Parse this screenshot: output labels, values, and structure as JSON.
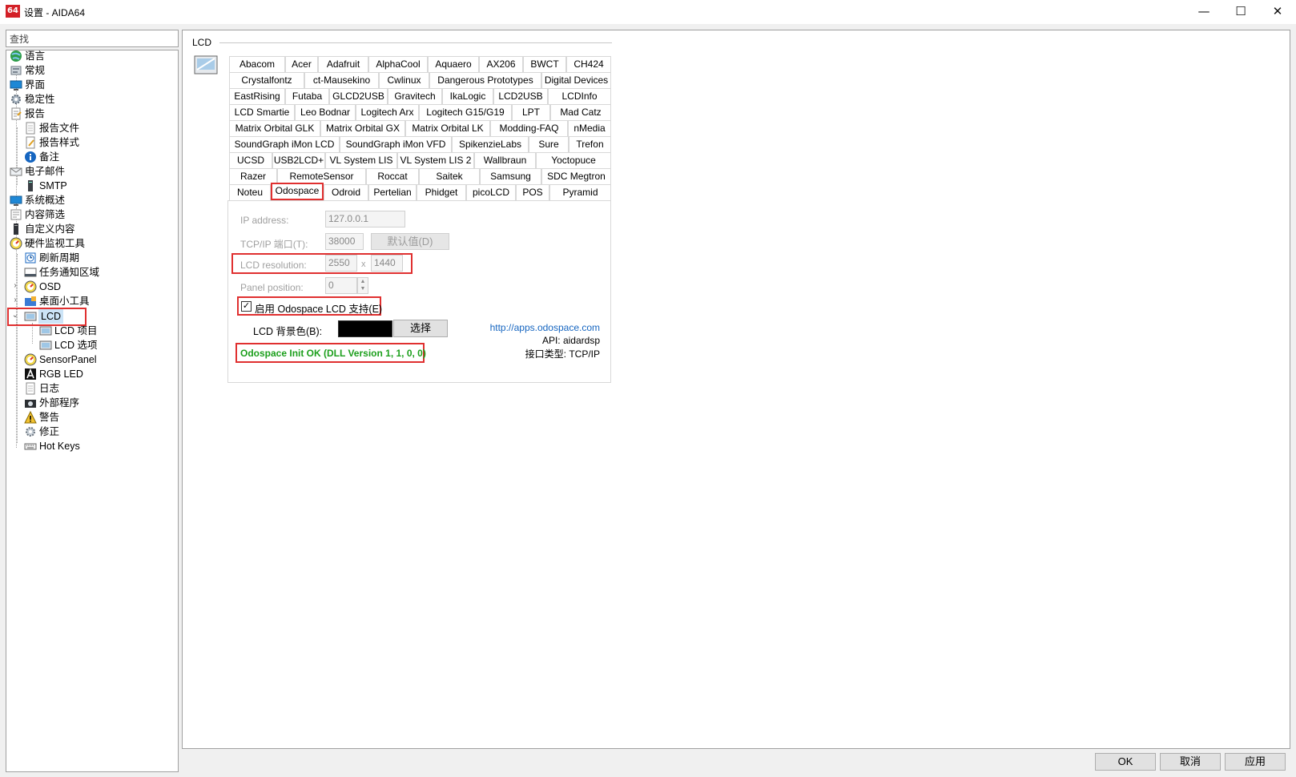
{
  "window": {
    "app_icon_text": "64",
    "title": "设置 - AIDA64",
    "minimize": "—",
    "maximize": "☐",
    "close": "✕"
  },
  "search": {
    "value": "查找"
  },
  "tree": {
    "items": [
      {
        "label": "语言",
        "icon": "globe-icon"
      },
      {
        "label": "常规",
        "icon": "settings-icon"
      },
      {
        "label": "界面",
        "icon": "monitor-icon"
      },
      {
        "label": "稳定性",
        "icon": "gear-icon"
      },
      {
        "label": "报告",
        "icon": "report-icon"
      },
      {
        "label": "报告文件",
        "icon": "file-icon"
      },
      {
        "label": "报告样式",
        "icon": "style-icon"
      },
      {
        "label": "备注",
        "icon": "info-icon"
      },
      {
        "label": "电子邮件",
        "icon": "email-icon"
      },
      {
        "label": "SMTP",
        "icon": "server-icon"
      },
      {
        "label": "系统概述",
        "icon": "monitor-icon"
      },
      {
        "label": "内容筛选",
        "icon": "filter-icon"
      },
      {
        "label": "自定义内容",
        "icon": "tower-icon"
      },
      {
        "label": "硬件监视工具",
        "icon": "gauge-icon"
      },
      {
        "label": "刷新周期",
        "icon": "clock-icon"
      },
      {
        "label": "任务通知区域",
        "icon": "taskbar-icon"
      },
      {
        "label": "OSD",
        "icon": "gauge-icon"
      },
      {
        "label": "桌面小工具",
        "icon": "gadget-icon"
      },
      {
        "label": "LCD",
        "icon": "lcd-icon"
      },
      {
        "label": "LCD 项目",
        "icon": "lcd-icon"
      },
      {
        "label": "LCD 选项",
        "icon": "lcd-icon"
      },
      {
        "label": "SensorPanel",
        "icon": "gauge-icon"
      },
      {
        "label": "RGB LED",
        "icon": "rgb-icon"
      },
      {
        "label": "日志",
        "icon": "log-icon"
      },
      {
        "label": "外部程序",
        "icon": "camera-icon"
      },
      {
        "label": "警告",
        "icon": "warning-icon"
      },
      {
        "label": "修正",
        "icon": "fix-icon"
      },
      {
        "label": "Hot Keys",
        "icon": "keyboard-icon"
      }
    ]
  },
  "main": {
    "section_title": "LCD",
    "tab_rows": [
      [
        "Abacom",
        "Acer",
        "Adafruit",
        "AlphaCool",
        "Aquaero",
        "AX206",
        "BWCT",
        "CH424"
      ],
      [
        "Crystalfontz",
        "ct-Mausekino",
        "Cwlinux",
        "Dangerous Prototypes",
        "Digital Devices"
      ],
      [
        "EastRising",
        "Futaba",
        "GLCD2USB",
        "Gravitech",
        "IkaLogic",
        "LCD2USB",
        "LCDInfo"
      ],
      [
        "LCD Smartie",
        "Leo Bodnar",
        "Logitech Arx",
        "Logitech G15/G19",
        "LPT",
        "Mad Catz"
      ],
      [
        "Matrix Orbital GLK",
        "Matrix Orbital GX",
        "Matrix Orbital LK",
        "Modding-FAQ",
        "nMedia"
      ],
      [
        "SoundGraph iMon LCD",
        "SoundGraph iMon VFD",
        "SpikenzieLabs",
        "Sure",
        "Trefon"
      ],
      [
        "UCSD",
        "USB2LCD+",
        "VL System LIS",
        "VL System LIS 2",
        "Wallbraun",
        "Yoctopuce"
      ],
      [
        "Razer",
        "RemoteSensor",
        "Roccat",
        "Saitek",
        "Samsung",
        "SDC Megtron"
      ],
      [
        "Noteu",
        "Odospace",
        "Odroid",
        "Pertelian",
        "Phidget",
        "picoLCD",
        "POS",
        "Pyramid"
      ]
    ],
    "active_tab": "Odospace",
    "odospace": {
      "ip_label": "IP address:",
      "ip_value": "127.0.0.1",
      "port_label": "TCP/IP 端口(T):",
      "port_value": "38000",
      "default_button": "默认值(D)",
      "resolution_label": "LCD resolution:",
      "res_width": "2550",
      "res_x": "x",
      "res_height": "1440",
      "panel_label": "Panel position:",
      "panel_value": "0",
      "enable_checked": true,
      "enable_label": "启用 Odospace LCD 支持(E)",
      "bgcolor_label": "LCD 背景色(B):",
      "bgcolor_value": "#000000",
      "choose_button": "选择",
      "status": "Odospace Init OK  (DLL Version 1, 1, 0, 0)",
      "link": "http://apps.odospace.com",
      "api": "API: aidardsp",
      "interface": "接口类型: TCP/IP"
    }
  },
  "footer": {
    "ok": "OK",
    "cancel": "取消",
    "apply": "应用"
  },
  "colors": {
    "highlight_red": "#e03030",
    "status_green": "#1c9f1c",
    "link_blue": "#1565c0"
  }
}
